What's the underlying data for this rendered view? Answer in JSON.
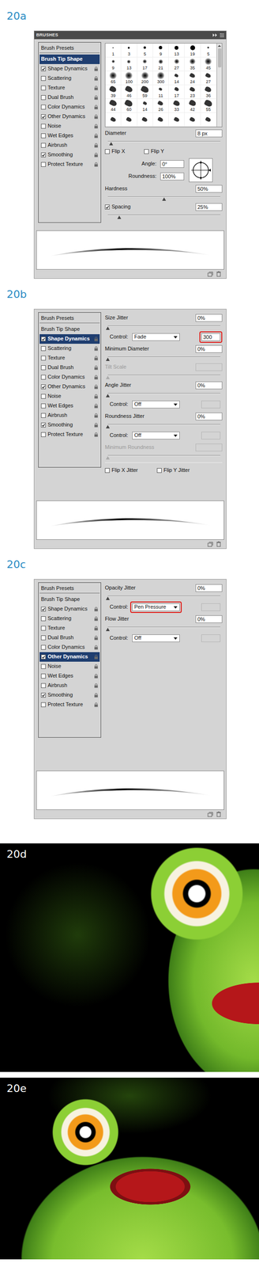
{
  "figures": [
    {
      "label": "20a",
      "kind": "panel",
      "panel": {
        "title": "BRUSHES",
        "sidebar": [
          {
            "label": "Brush Presets",
            "kind": "header",
            "selected": false
          },
          {
            "label": "Brush Tip Shape",
            "kind": "plain",
            "selected": true
          },
          {
            "label": "Shape Dynamics",
            "kind": "option",
            "checked": true,
            "selected": false
          },
          {
            "label": "Scattering",
            "kind": "option",
            "checked": false,
            "selected": false
          },
          {
            "label": "Texture",
            "kind": "option",
            "checked": false,
            "selected": false
          },
          {
            "label": "Dual Brush",
            "kind": "option",
            "checked": false,
            "selected": false
          },
          {
            "label": "Color Dynamics",
            "kind": "option",
            "checked": false,
            "selected": false
          },
          {
            "label": "Other Dynamics",
            "kind": "option",
            "checked": true,
            "selected": false
          },
          {
            "label": "Noise",
            "kind": "option",
            "checked": false,
            "selected": false
          },
          {
            "label": "Wet Edges",
            "kind": "option",
            "checked": false,
            "selected": false
          },
          {
            "label": "Airbrush",
            "kind": "option",
            "checked": false,
            "selected": false
          },
          {
            "label": "Smoothing",
            "kind": "option",
            "checked": true,
            "selected": false
          },
          {
            "label": "Protect Texture",
            "kind": "option",
            "checked": false,
            "selected": false
          }
        ],
        "rows": [
          {
            "kind": "grid",
            "tips": [
              {
                "size": "1",
                "tip": "hard"
              },
              {
                "size": "3",
                "tip": "hard"
              },
              {
                "size": "5",
                "tip": "hard"
              },
              {
                "size": "9",
                "tip": "hard"
              },
              {
                "size": "13",
                "tip": "hard"
              },
              {
                "size": "19",
                "tip": "hard"
              },
              {
                "size": "5",
                "tip": "soft"
              },
              {
                "size": "9",
                "tip": "soft"
              },
              {
                "size": "13",
                "tip": "soft"
              },
              {
                "size": "17",
                "tip": "soft"
              },
              {
                "size": "21",
                "tip": "soft"
              },
              {
                "size": "27",
                "tip": "soft"
              },
              {
                "size": "35",
                "tip": "soft"
              },
              {
                "size": "45",
                "tip": "soft"
              },
              {
                "size": "65",
                "tip": "soft"
              },
              {
                "size": "100",
                "tip": "soft"
              },
              {
                "size": "200",
                "tip": "soft"
              },
              {
                "size": "300",
                "tip": "soft"
              },
              {
                "size": "14",
                "tip": "shape"
              },
              {
                "size": "24",
                "tip": "shape"
              },
              {
                "size": "27",
                "tip": "shape"
              },
              {
                "size": "39",
                "tip": "shape"
              },
              {
                "size": "46",
                "tip": "shape"
              },
              {
                "size": "59",
                "tip": "shape"
              },
              {
                "size": "11",
                "tip": "shape"
              },
              {
                "size": "17",
                "tip": "shape"
              },
              {
                "size": "23",
                "tip": "shape"
              },
              {
                "size": "36",
                "tip": "shape"
              },
              {
                "size": "44",
                "tip": "shape"
              },
              {
                "size": "60",
                "tip": "shape"
              },
              {
                "size": "14",
                "tip": "shape"
              },
              {
                "size": "26",
                "tip": "shape"
              },
              {
                "size": "33",
                "tip": "shape"
              },
              {
                "size": "42",
                "tip": "shape"
              },
              {
                "size": "55",
                "tip": "shape"
              },
              {
                "tip": "shape"
              },
              {
                "tip": "shape"
              },
              {
                "tip": "shape"
              },
              {
                "tip": "shape"
              },
              {
                "tip": "shape"
              },
              {
                "tip": "shape"
              },
              {
                "tip": "shape"
              }
            ]
          },
          {
            "kind": "value",
            "label": "Diameter",
            "value": "8 px"
          },
          {
            "kind": "slider",
            "level": 0.03
          },
          {
            "kind": "checks",
            "items": [
              {
                "label": "Flip X",
                "checked": false
              },
              {
                "label": "Flip Y",
                "checked": false
              }
            ]
          },
          {
            "kind": "angle",
            "items": [
              {
                "label": "Angle:",
                "value": "0°"
              },
              {
                "label": "Roundness:",
                "value": "100%"
              }
            ]
          },
          {
            "kind": "value",
            "label": "Hardness",
            "value": "50%"
          },
          {
            "kind": "slider",
            "level": 0.5
          },
          {
            "kind": "value",
            "label": "Spacing",
            "value": "25%",
            "checked": true
          },
          {
            "kind": "slider",
            "level": 0.1
          }
        ]
      }
    },
    {
      "label": "20b",
      "kind": "panel",
      "panel": {
        "sidebar": [
          {
            "label": "Brush Presets",
            "kind": "header",
            "selected": false
          },
          {
            "label": "Brush Tip Shape",
            "kind": "plain",
            "selected": false
          },
          {
            "label": "Shape Dynamics",
            "kind": "option",
            "checked": true,
            "selected": true
          },
          {
            "label": "Scattering",
            "kind": "option",
            "checked": false,
            "selected": false
          },
          {
            "label": "Texture",
            "kind": "option",
            "checked": false,
            "selected": false
          },
          {
            "label": "Dual Brush",
            "kind": "option",
            "checked": false,
            "selected": false
          },
          {
            "label": "Color Dynamics",
            "kind": "option",
            "checked": false,
            "selected": false
          },
          {
            "label": "Other Dynamics",
            "kind": "option",
            "checked": true,
            "selected": false
          },
          {
            "label": "Noise",
            "kind": "option",
            "checked": false,
            "selected": false
          },
          {
            "label": "Wet Edges",
            "kind": "option",
            "checked": false,
            "selected": false
          },
          {
            "label": "Airbrush",
            "kind": "option",
            "checked": false,
            "selected": false
          },
          {
            "label": "Smoothing",
            "kind": "option",
            "checked": true,
            "selected": false
          },
          {
            "label": "Protect Texture",
            "kind": "option",
            "checked": false,
            "selected": false
          }
        ],
        "rows": [
          {
            "kind": "value",
            "label": "Size Jitter",
            "value": "0%"
          },
          {
            "kind": "slider",
            "level": 0
          },
          {
            "kind": "control",
            "label": "Control:",
            "value": "Fade",
            "highlight": false,
            "field": {
              "value": "300",
              "disabled": false,
              "highlight": true
            }
          },
          {
            "kind": "value",
            "label": "Minimum Diameter",
            "value": "0%"
          },
          {
            "kind": "slider",
            "level": 0
          },
          {
            "kind": "value",
            "label": "Tilt Scale",
            "disabled": true
          },
          {
            "kind": "slider",
            "level": 0,
            "disabled": true
          },
          {
            "kind": "value",
            "label": "Angle Jitter",
            "value": "0%"
          },
          {
            "kind": "slider",
            "level": 0
          },
          {
            "kind": "control",
            "label": "Control:",
            "value": "Off",
            "highlight": false,
            "field": {
              "disabled": true,
              "highlight": false
            }
          },
          {
            "kind": "value",
            "label": "Roundness Jitter",
            "value": "0%"
          },
          {
            "kind": "slider",
            "level": 0
          },
          {
            "kind": "control",
            "label": "Control:",
            "value": "Off",
            "highlight": false,
            "field": {
              "disabled": true,
              "highlight": false
            }
          },
          {
            "kind": "value",
            "label": "Minimum Roundness",
            "disabled": true
          },
          {
            "kind": "slider",
            "level": 0,
            "disabled": true
          },
          {
            "kind": "divider"
          },
          {
            "kind": "checks",
            "items": [
              {
                "label": "Flip X Jitter",
                "checked": false
              },
              {
                "label": "Flip Y Jitter",
                "checked": false
              }
            ]
          }
        ]
      }
    },
    {
      "label": "20c",
      "kind": "panel",
      "panel": {
        "sidebar": [
          {
            "label": "Brush Presets",
            "kind": "header",
            "selected": false
          },
          {
            "label": "Brush Tip Shape",
            "kind": "plain",
            "selected": false
          },
          {
            "label": "Shape Dynamics",
            "kind": "option",
            "checked": true,
            "selected": false
          },
          {
            "label": "Scattering",
            "kind": "option",
            "checked": false,
            "selected": false
          },
          {
            "label": "Texture",
            "kind": "option",
            "checked": false,
            "selected": false
          },
          {
            "label": "Dual Brush",
            "kind": "option",
            "checked": false,
            "selected": false
          },
          {
            "label": "Color Dynamics",
            "kind": "option",
            "checked": false,
            "selected": false
          },
          {
            "label": "Other Dynamics",
            "kind": "option",
            "checked": true,
            "selected": true
          },
          {
            "label": "Noise",
            "kind": "option",
            "checked": false,
            "selected": false
          },
          {
            "label": "Wet Edges",
            "kind": "option",
            "checked": false,
            "selected": false
          },
          {
            "label": "Airbrush",
            "kind": "option",
            "checked": false,
            "selected": false
          },
          {
            "label": "Smoothing",
            "kind": "option",
            "checked": true,
            "selected": false
          },
          {
            "label": "Protect Texture",
            "kind": "option",
            "checked": false,
            "selected": false
          }
        ],
        "rows": [
          {
            "kind": "value",
            "label": "Opacity Jitter",
            "value": "0%"
          },
          {
            "kind": "slider",
            "level": 0
          },
          {
            "kind": "control",
            "label": "Control:",
            "value": "Pen Pressure",
            "highlight": true,
            "field": {
              "disabled": true,
              "highlight": false
            }
          },
          {
            "kind": "value",
            "label": "Flow Jitter",
            "value": "0%"
          },
          {
            "kind": "slider",
            "level": 0
          },
          {
            "kind": "control",
            "label": "Control:",
            "value": "Off",
            "highlight": false,
            "field": {
              "disabled": true,
              "highlight": false
            }
          }
        ]
      }
    },
    {
      "label": "20d",
      "kind": "artwork"
    },
    {
      "label": "20e",
      "kind": "artwork"
    }
  ]
}
